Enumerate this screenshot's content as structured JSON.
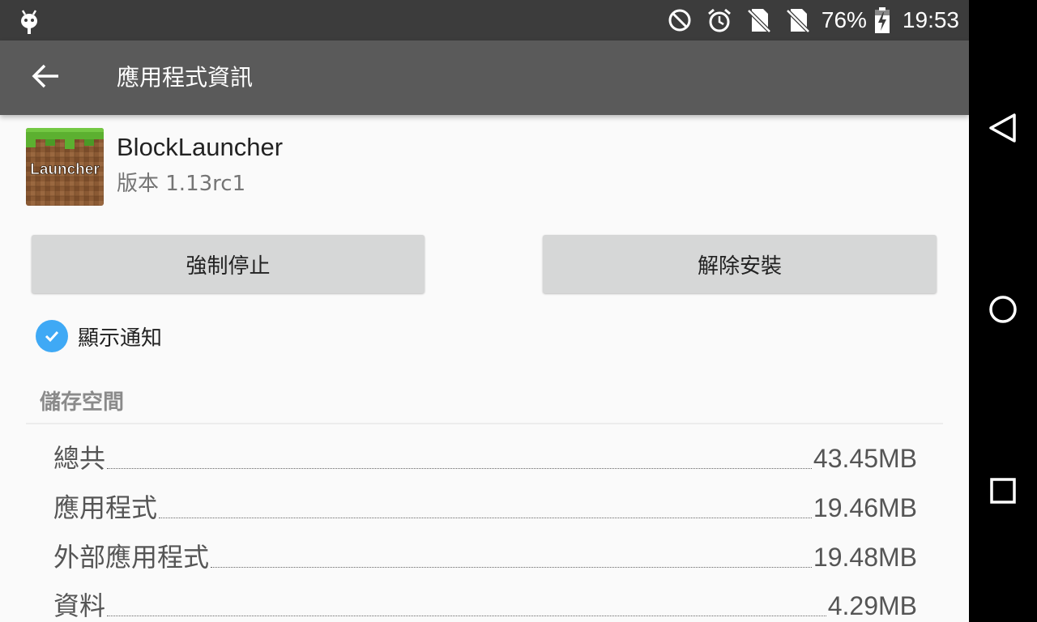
{
  "status_bar": {
    "battery_percent": "76%",
    "time": "19:53",
    "icons": [
      "android-debug-icon",
      "do-not-disturb-icon",
      "alarm-icon",
      "no-sim-icon",
      "no-sim-icon",
      "battery-charging-icon"
    ]
  },
  "app_bar": {
    "title": "應用程式資訊",
    "back_icon": "arrow-back-icon"
  },
  "app": {
    "name": "BlockLauncher",
    "version": "版本 1.13rc1",
    "icon_text": "Launcher"
  },
  "buttons": {
    "force_stop": "強制停止",
    "uninstall": "解除安裝"
  },
  "notifications": {
    "label": "顯示通知",
    "checked": true
  },
  "storage": {
    "header": "儲存空間",
    "rows": [
      {
        "label": "總共",
        "value": "43.45MB"
      },
      {
        "label": "應用程式",
        "value": "19.46MB"
      },
      {
        "label": "外部應用程式",
        "value": "19.48MB"
      },
      {
        "label": "資料",
        "value": "4.29MB"
      }
    ]
  },
  "colors": {
    "status_bar": "#3c3c3c",
    "app_bar": "#5a5a5a",
    "accent": "#3fa9f5",
    "button": "#d6d7d7"
  }
}
